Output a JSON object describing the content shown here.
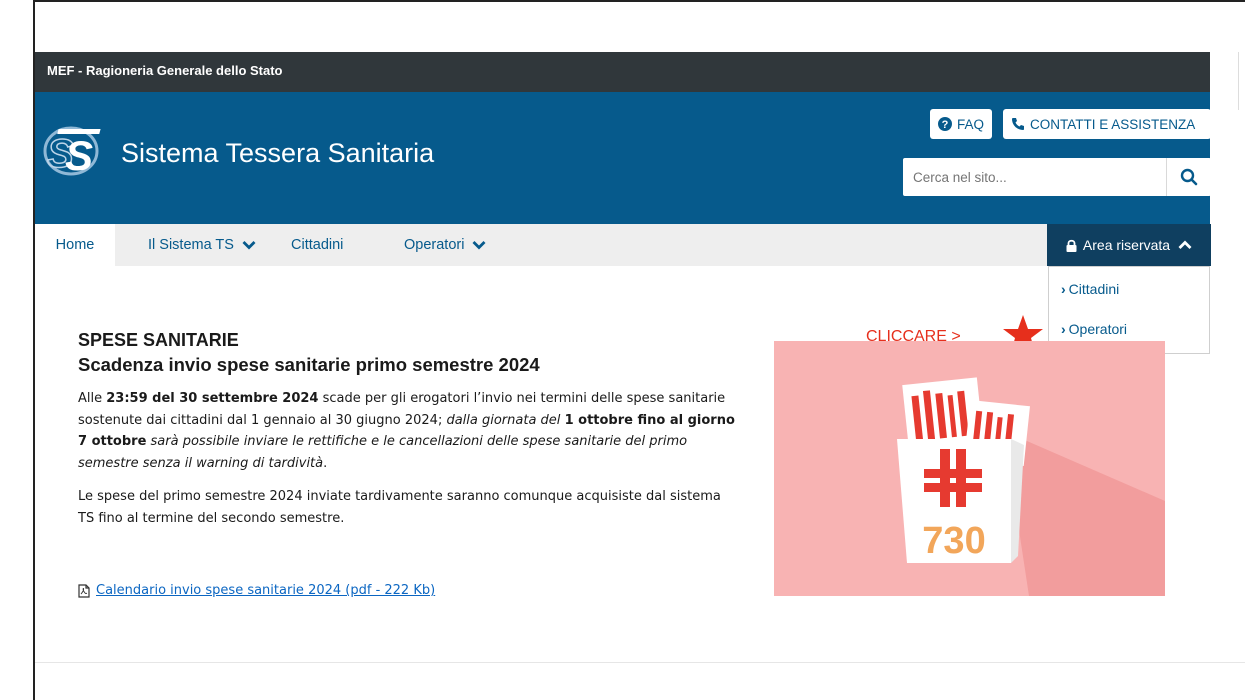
{
  "topbar": {
    "org": "MEF - Ragioneria Generale dello Stato"
  },
  "header": {
    "title": "Sistema Tessera Sanitaria",
    "faq_label": "FAQ",
    "contatti_label": "CONTATTI E ASSISTENZA",
    "search_placeholder": "Cerca nel sito..."
  },
  "nav": {
    "home": "Home",
    "sistema": "Il Sistema TS",
    "cittadini": "Cittadini",
    "operatori": "Operatori",
    "area_riservata": "Area riservata"
  },
  "dropdown": {
    "items": [
      "Cittadini",
      "Operatori"
    ]
  },
  "main": {
    "kicker": "SPESE SANITARIE",
    "headline": "Scadenza invio spese sanitarie primo semestre 2024",
    "p1_bold1": "23:59 del 30 settembre 2024",
    "p1_text1": "Alle ",
    "p1_text2": " scade per gli erogatori l’invio nei termini delle spese sanitarie sostenute dai cittadini dal 1 gennaio al 30 giugno 2024; ",
    "p1_italic1": "dalla giornata del ",
    "p1_bold2": "1 ottobre fino al giorno 7 ottobre",
    "p1_italic2": " sarà possibile inviare le rettifiche e le cancellazioni delle spese sanitarie del primo semestre senza il warning di tardività",
    "p1_end": ".",
    "p2": "Le spese del primo semestre 2024 inviate tardivamente saranno comunque acquisiste dal sistema TS fino al termine del secondo semestre.",
    "pdf_link": "Calendario invio spese sanitarie 2024 (pdf - 222 Kb)"
  },
  "annotation": {
    "text": "CLICCARE >"
  },
  "promo": {
    "number_text": "730"
  },
  "colors": {
    "header_blue": "#065a8c",
    "dark_strip": "#30373b",
    "area_dark": "#0f3f60",
    "accent_red": "#e62f1c",
    "promo_pink": "#f8b3b3"
  },
  "icons": [
    "ts-logo",
    "question-circle-icon",
    "phone-icon",
    "search-icon",
    "chevron-down-icon",
    "lock-icon",
    "chevron-up-icon",
    "chevron-right-icon",
    "pdf-file-icon",
    "star-icon"
  ]
}
